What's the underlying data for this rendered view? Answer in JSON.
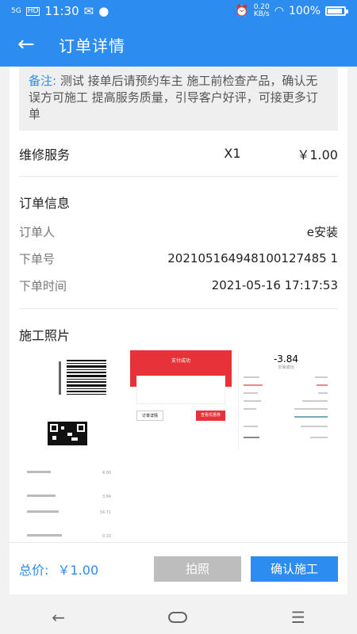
{
  "status_bar": {
    "signal": "5G",
    "hd": "HD",
    "time": "11:30",
    "speed": "0.20",
    "speed_unit": "KB/s",
    "battery": "100%",
    "battery_level": 1.0
  },
  "header": {
    "title": "订单详情"
  },
  "remark": {
    "label": "备注:",
    "text": " 测试 接单后请预约车主 施工前检查产品，确认无误方可施工 提高服务质量，引导客户好评，可接更多订单"
  },
  "service": {
    "name": "维修服务",
    "qty": "X1",
    "price": "￥1.00"
  },
  "order_info": {
    "title": "订单信息",
    "rows": [
      {
        "label": "订单人",
        "value": "e安装"
      },
      {
        "label": "下单号",
        "value": "202105164948100127485 1"
      },
      {
        "label": "下单时间",
        "value": "2021-05-16 17:17:53"
      }
    ]
  },
  "photos": {
    "title": "施工照片",
    "receipt_amount": "-3.84",
    "receipt_status": "交易成功",
    "payment_title": "支付成功",
    "payment_btn_left": "订单详情",
    "payment_btn_right": "查看优惠券",
    "list_amounts": [
      "4.00",
      "3.84",
      "34.71",
      "0.10"
    ]
  },
  "footer": {
    "total_label": "总价:",
    "total_value": "￥1.00",
    "photo_button": "拍照",
    "confirm_button": "确认施工"
  }
}
